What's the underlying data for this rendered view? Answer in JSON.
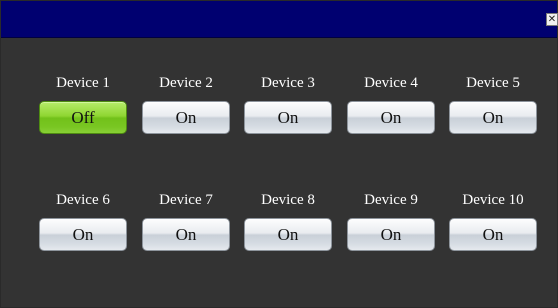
{
  "window": {
    "title": "",
    "close_glyph": "✕"
  },
  "devices": [
    {
      "label": "Device 1",
      "button": "Off",
      "state": "off"
    },
    {
      "label": "Device 2",
      "button": "On",
      "state": "on"
    },
    {
      "label": "Device 3",
      "button": "On",
      "state": "on"
    },
    {
      "label": "Device 4",
      "button": "On",
      "state": "on"
    },
    {
      "label": "Device 5",
      "button": "On",
      "state": "on"
    },
    {
      "label": "Device 6",
      "button": "On",
      "state": "on"
    },
    {
      "label": "Device 7",
      "button": "On",
      "state": "on"
    },
    {
      "label": "Device 8",
      "button": "On",
      "state": "on"
    },
    {
      "label": "Device 9",
      "button": "On",
      "state": "on"
    },
    {
      "label": "Device 10",
      "button": "On",
      "state": "on"
    }
  ],
  "colors": {
    "titlebar": "#000070",
    "background": "#333333",
    "off_button": "#8fd632",
    "on_button": "#d6dce3"
  }
}
